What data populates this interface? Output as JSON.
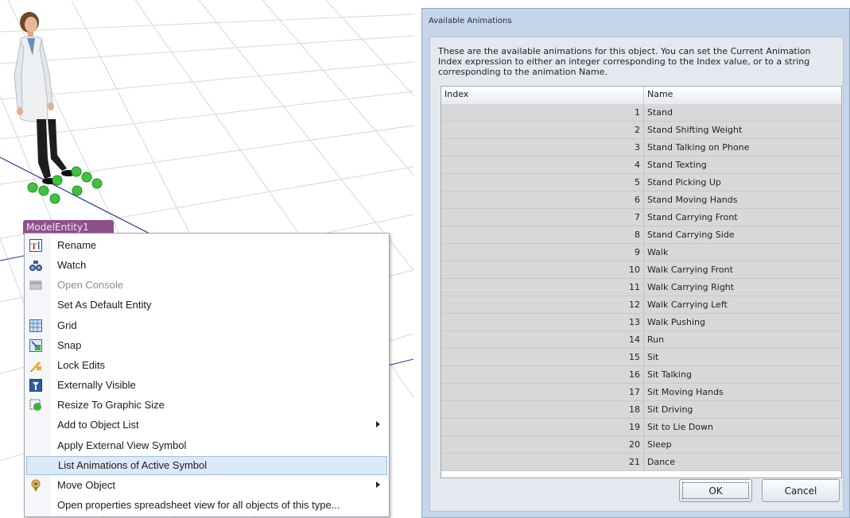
{
  "viewport": {
    "entity_label": "ModelEntity1",
    "selection_color": "#39c23a"
  },
  "context_menu": {
    "items": [
      {
        "label": "Rename",
        "icon": "rename-icon"
      },
      {
        "label": "Watch",
        "icon": "binoculars-icon"
      },
      {
        "label": "Open Console",
        "icon": "console-icon",
        "disabled": true
      },
      {
        "label": "Set As Default Entity",
        "icon": ""
      },
      {
        "label": "Grid",
        "icon": "grid-icon"
      },
      {
        "label": "Snap",
        "icon": "snap-icon"
      },
      {
        "label": "Lock Edits",
        "icon": "lock-edits-icon"
      },
      {
        "label": "Externally Visible",
        "icon": "externally-visible-icon"
      },
      {
        "label": "Resize To Graphic Size",
        "icon": "resize-icon"
      },
      {
        "label": "Add to Object List",
        "icon": "",
        "submenu": true
      },
      {
        "label": "Apply External View Symbol",
        "icon": ""
      },
      {
        "label": "List Animations of Active Symbol",
        "icon": "",
        "highlighted": true
      },
      {
        "label": "Move Object",
        "icon": "move-object-icon",
        "submenu": true
      },
      {
        "label": "Open properties spreadsheet view for all objects of this type...",
        "icon": ""
      }
    ]
  },
  "dialog": {
    "title": "Available Animations",
    "description": "These are the available animations for this object. You can set the Current Animation Index expression to either an integer corresponding to the Index value, or to a string corresponding to the animation Name.",
    "columns": {
      "index": "Index",
      "name": "Name"
    },
    "rows": [
      {
        "index": "1",
        "name": "Stand"
      },
      {
        "index": "2",
        "name": "Stand Shifting Weight"
      },
      {
        "index": "3",
        "name": "Stand Talking on Phone"
      },
      {
        "index": "4",
        "name": "Stand Texting"
      },
      {
        "index": "5",
        "name": "Stand Picking Up"
      },
      {
        "index": "6",
        "name": "Stand Moving Hands"
      },
      {
        "index": "7",
        "name": "Stand Carrying Front"
      },
      {
        "index": "8",
        "name": "Stand Carrying Side"
      },
      {
        "index": "9",
        "name": "Walk"
      },
      {
        "index": "10",
        "name": "Walk Carrying Front"
      },
      {
        "index": "11",
        "name": "Walk Carrying Right"
      },
      {
        "index": "12",
        "name": "Walk Carrying Left"
      },
      {
        "index": "13",
        "name": "Walk Pushing"
      },
      {
        "index": "14",
        "name": "Run"
      },
      {
        "index": "15",
        "name": "Sit"
      },
      {
        "index": "16",
        "name": "Sit Talking"
      },
      {
        "index": "17",
        "name": "Sit Moving Hands"
      },
      {
        "index": "18",
        "name": "Sit Driving"
      },
      {
        "index": "19",
        "name": "Sit to Lie Down"
      },
      {
        "index": "20",
        "name": "Sleep"
      },
      {
        "index": "21",
        "name": "Dance"
      }
    ],
    "ok_label": "OK",
    "cancel_label": "Cancel"
  }
}
